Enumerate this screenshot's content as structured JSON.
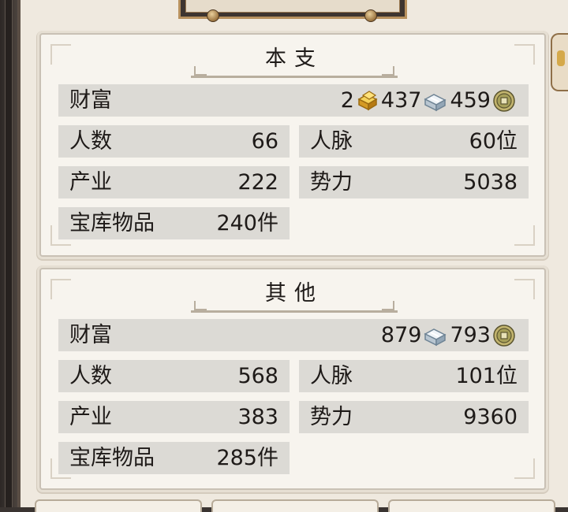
{
  "sections": [
    {
      "title": "本支",
      "wealth": {
        "label": "财富",
        "gold": "2",
        "silver": "437",
        "copper": "459"
      },
      "population": {
        "label": "人数",
        "value": "66"
      },
      "connections": {
        "label": "人脉",
        "value": "60位"
      },
      "property": {
        "label": "产业",
        "value": "222"
      },
      "influence": {
        "label": "势力",
        "value": "5038"
      },
      "treasury": {
        "label": "宝库物品",
        "value": "240件"
      }
    },
    {
      "title": "其他",
      "wealth": {
        "label": "财富",
        "silver": "879",
        "copper": "793"
      },
      "population": {
        "label": "人数",
        "value": "568"
      },
      "connections": {
        "label": "人脉",
        "value": "101位"
      },
      "property": {
        "label": "产业",
        "value": "383"
      },
      "influence": {
        "label": "势力",
        "value": "9360"
      },
      "treasury": {
        "label": "宝库物品",
        "value": "285件"
      }
    }
  ],
  "icons": {
    "gold": "gold-ingot-icon",
    "silver": "silver-ingot-icon",
    "copper": "copper-coin-icon"
  },
  "colors": {
    "row_bg": "#dcdad5",
    "panel_bg": "#f7f4ee",
    "frame": "#b8915e"
  }
}
